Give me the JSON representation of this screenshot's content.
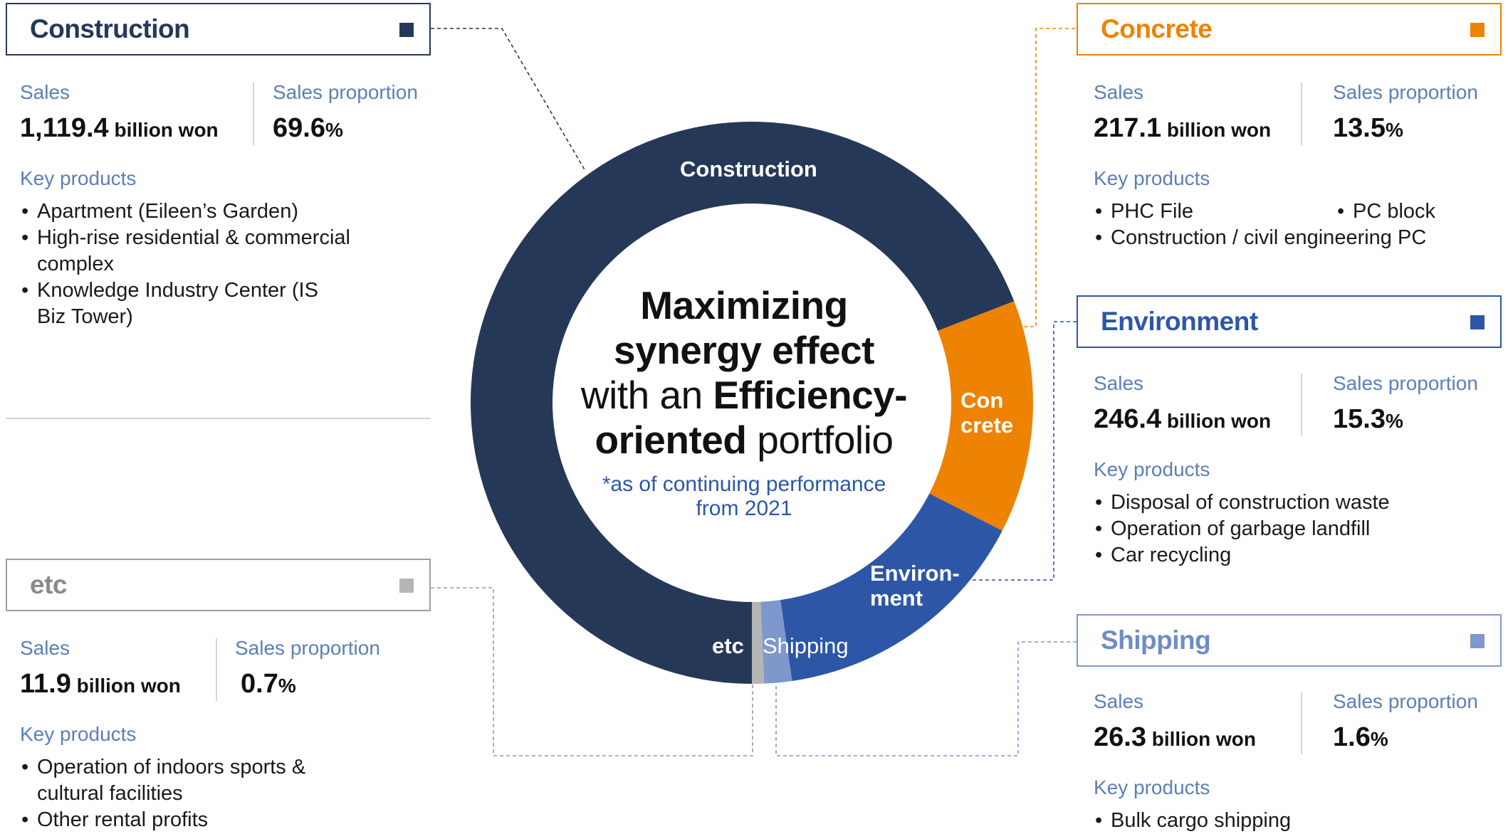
{
  "colors": {
    "construction": "#263857",
    "concrete": "#ee8203",
    "environment": "#2d57a6",
    "shipping": "#7e98cc",
    "etc": "#b5b5b5",
    "label_blue": "#5b80b5"
  },
  "chart_data": {
    "type": "pie",
    "categories": [
      "Construction",
      "Concrete",
      "Environment",
      "Shipping",
      "etc"
    ],
    "values": [
      69.6,
      13.5,
      15.3,
      1.6,
      0.7
    ],
    "unit": "%",
    "title": "Maximizing synergy effect with an Efficiency-oriented portfolio",
    "subtitle": "*as of continuing performance from 2021",
    "segment_labels": [
      "Construction",
      "Con crete",
      "Environ- ment",
      "Shipping",
      "etc"
    ]
  },
  "center": {
    "line1": "Maximizing",
    "line2": "synergy effect",
    "line3_a": "with an ",
    "line3_b": "Efficiency-",
    "line4_a": "oriented",
    "line4_b": " portfolio",
    "note_line1": "*as of continuing performance",
    "note_line2": "from 2021"
  },
  "segments": {
    "construction": "Construction",
    "concrete_1": "Con",
    "concrete_2": "crete",
    "environment_1": "Environ-",
    "environment_2": "ment",
    "shipping": "Shipping",
    "etc": "etc"
  },
  "cards": {
    "construction": {
      "title": "Construction",
      "sales_label": "Sales",
      "sales_value": "1,119.4",
      "sales_unit": " billion won",
      "proportion_label": "Sales proportion",
      "proportion_value": "69.6",
      "proportion_unit": "%",
      "key_label": "Key products",
      "products": [
        "Apartment (Eileen’s Garden)",
        "High-rise residential & commercial complex",
        "Knowledge Industry Center (IS Biz Tower)"
      ]
    },
    "concrete": {
      "title": "Concrete",
      "sales_label": "Sales",
      "sales_value": "217.1",
      "sales_unit": " billion won",
      "proportion_label": "Sales proportion",
      "proportion_value": "13.5",
      "proportion_unit": "%",
      "key_label": "Key products",
      "products": [
        "PHC File",
        "PC block",
        "Construction / civil engineering PC"
      ]
    },
    "environment": {
      "title": "Environment",
      "sales_label": "Sales",
      "sales_value": "246.4",
      "sales_unit": " billion won",
      "proportion_label": "Sales proportion",
      "proportion_value": "15.3",
      "proportion_unit": "%",
      "key_label": "Key products",
      "products": [
        "Disposal of construction waste",
        "Operation of garbage landfill",
        "Car recycling"
      ]
    },
    "shipping": {
      "title": "Shipping",
      "sales_label": "Sales",
      "sales_value": "26.3",
      "sales_unit": " billion won",
      "proportion_label": "Sales proportion",
      "proportion_value": "1.6",
      "proportion_unit": "%",
      "key_label": "Key products",
      "products": [
        "Bulk cargo shipping"
      ]
    },
    "etc": {
      "title": "etc",
      "sales_label": "Sales",
      "sales_value": "11.9",
      "sales_unit": " billion won",
      "proportion_label": "Sales proportion",
      "proportion_value": "0.7",
      "proportion_unit": "%",
      "key_label": "Key products",
      "products": [
        "Operation of indoors sports & cultural facilities",
        "Other rental profits"
      ]
    }
  }
}
